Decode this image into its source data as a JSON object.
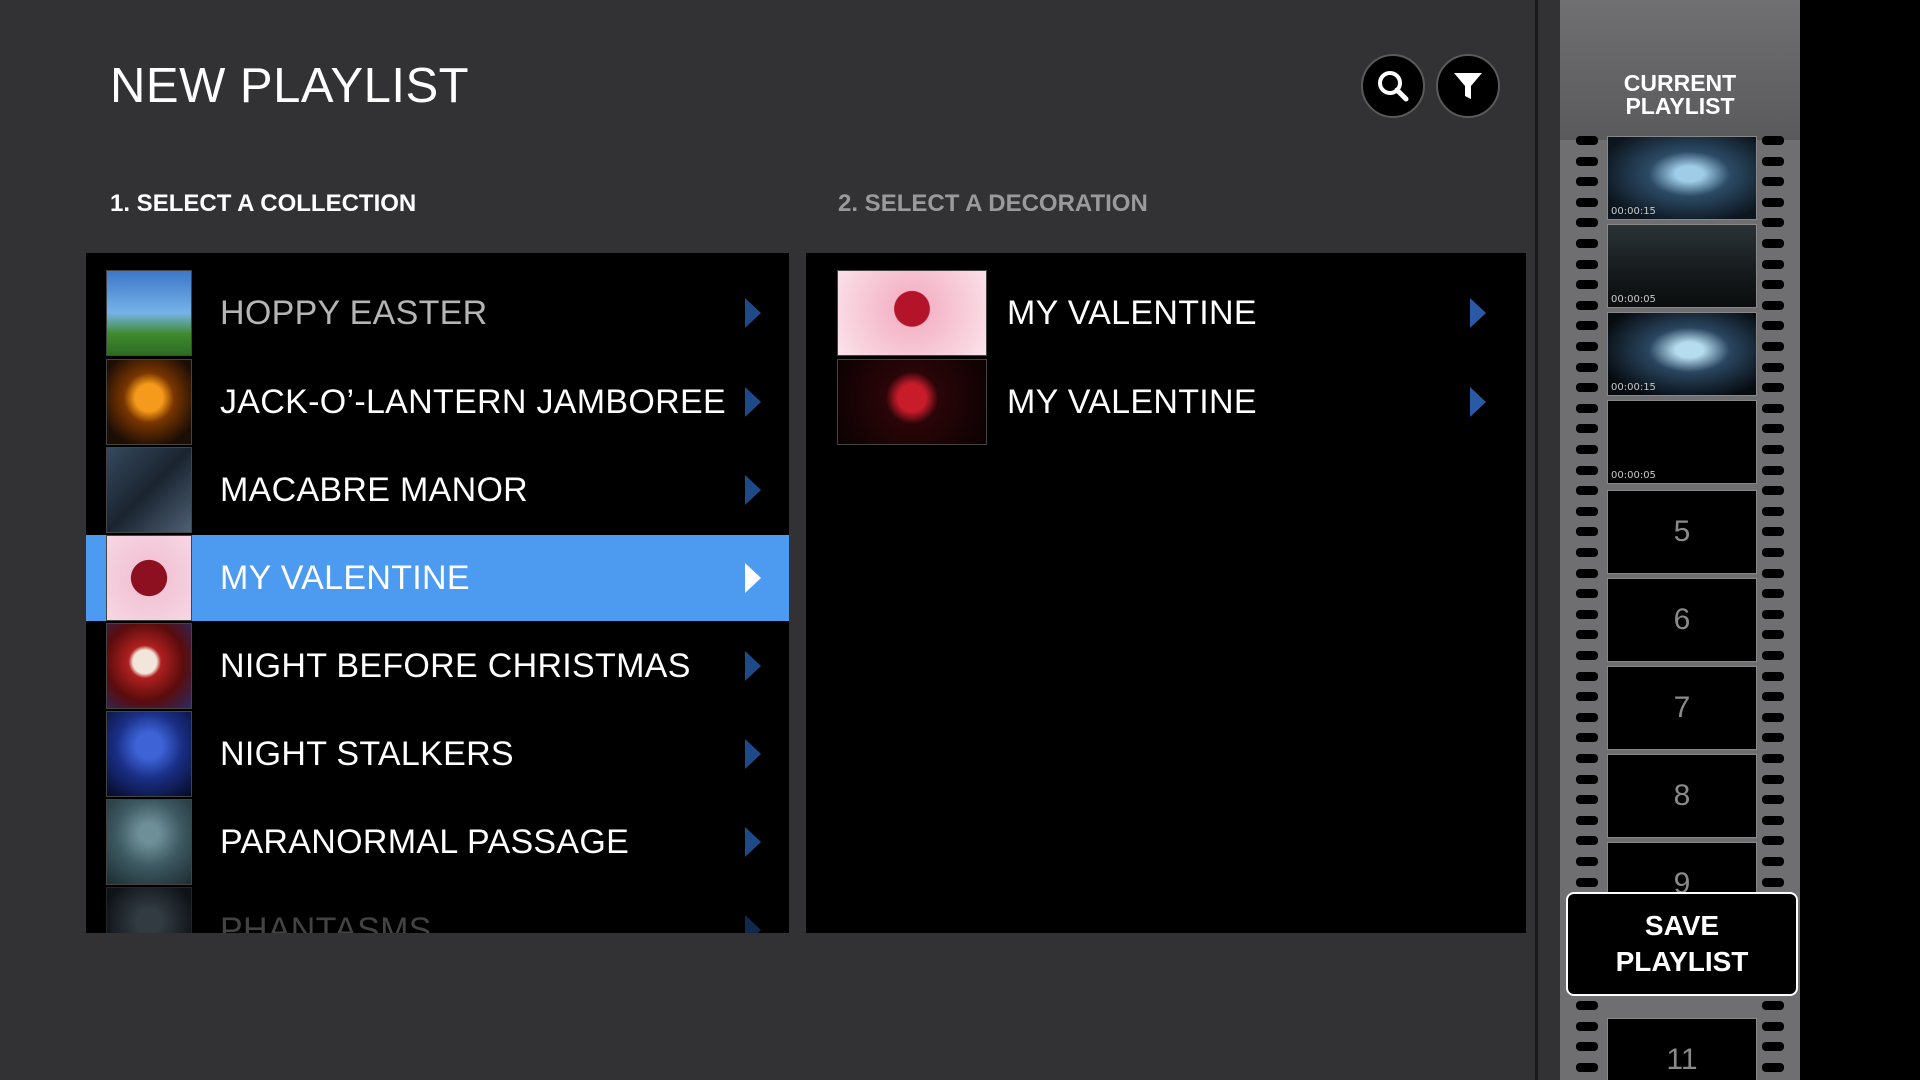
{
  "header": {
    "title": "NEW PLAYLIST",
    "search_icon": "search-icon",
    "filter_icon": "filter-icon"
  },
  "steps": {
    "collection_label": "1. SELECT A COLLECTION",
    "decoration_label": "2. SELECT A DECORATION"
  },
  "collections": {
    "items": [
      {
        "label": "HOPPY EASTER"
      },
      {
        "label": "JACK-O’-LANTERN JAMBOREE"
      },
      {
        "label": "MACABRE MANOR"
      },
      {
        "label": "MY VALENTINE",
        "selected": true
      },
      {
        "label": "NIGHT BEFORE CHRISTMAS"
      },
      {
        "label": "NIGHT STALKERS"
      },
      {
        "label": "PARANORMAL PASSAGE"
      },
      {
        "label": "PHANTASMS"
      }
    ]
  },
  "decorations": {
    "items": [
      {
        "label": "MY VALENTINE"
      },
      {
        "label": "MY VALENTINE"
      }
    ]
  },
  "playlist": {
    "title_line1": "CURRENT",
    "title_line2": "PLAYLIST",
    "frames": [
      {
        "time": "00:00:15"
      },
      {
        "time": "00:00:05"
      },
      {
        "time": "00:00:15"
      },
      {
        "time": "00:00:05"
      },
      {
        "number": "5"
      },
      {
        "number": "6"
      },
      {
        "number": "7"
      },
      {
        "number": "8"
      },
      {
        "number": "9"
      },
      {
        "number": "11"
      }
    ],
    "save_line1": "SAVE",
    "save_line2": "PLAYLIST"
  }
}
